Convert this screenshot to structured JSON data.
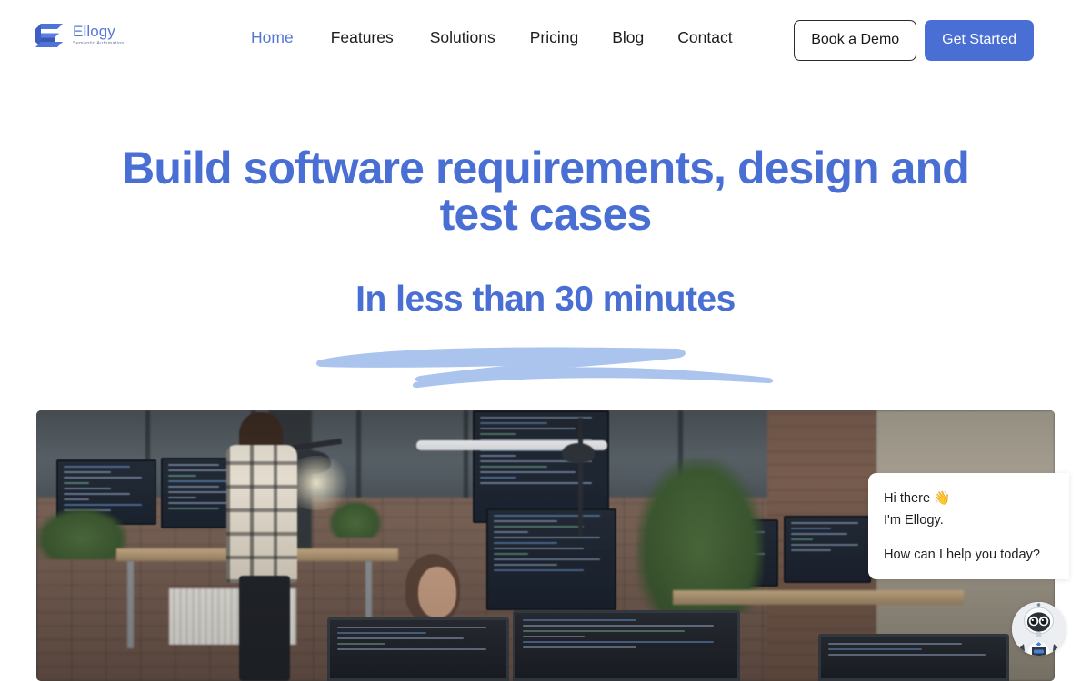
{
  "brand": {
    "name": "Ellogy",
    "tagline": "Semantic Automation",
    "logo_icon": "ellogy-e-logo-icon",
    "color": "#5577d6"
  },
  "nav": {
    "items": [
      {
        "label": "Home",
        "active": true
      },
      {
        "label": "Features",
        "active": false
      },
      {
        "label": "Solutions",
        "active": false
      },
      {
        "label": "Pricing",
        "active": false
      },
      {
        "label": "Blog",
        "active": false
      },
      {
        "label": "Contact",
        "active": false
      }
    ],
    "active_color": "#5577d6",
    "inactive_color": "#1d1d1f"
  },
  "header_actions": {
    "demo_label": "Book a Demo",
    "get_started_label": "Get Started",
    "primary_color": "#4a6fd4"
  },
  "hero": {
    "title": "Build software requirements, design and test cases",
    "subtitle": "In less than 30 minutes",
    "title_color": "#4a6fd4",
    "underline_color": "#aac4ee",
    "underline_icon": "hand-drawn-swoosh-underline-icon",
    "image_alt": "office-developers-at-desks-photo"
  },
  "chat": {
    "greeting_line1": "Hi there 👋",
    "greeting_line2": "I'm Ellogy.",
    "prompt": "How can I help you today?",
    "avatar_icon": "robot-assistant-avatar-icon",
    "bubble_bg": "#ffffff",
    "text_color": "#1f1f23"
  }
}
